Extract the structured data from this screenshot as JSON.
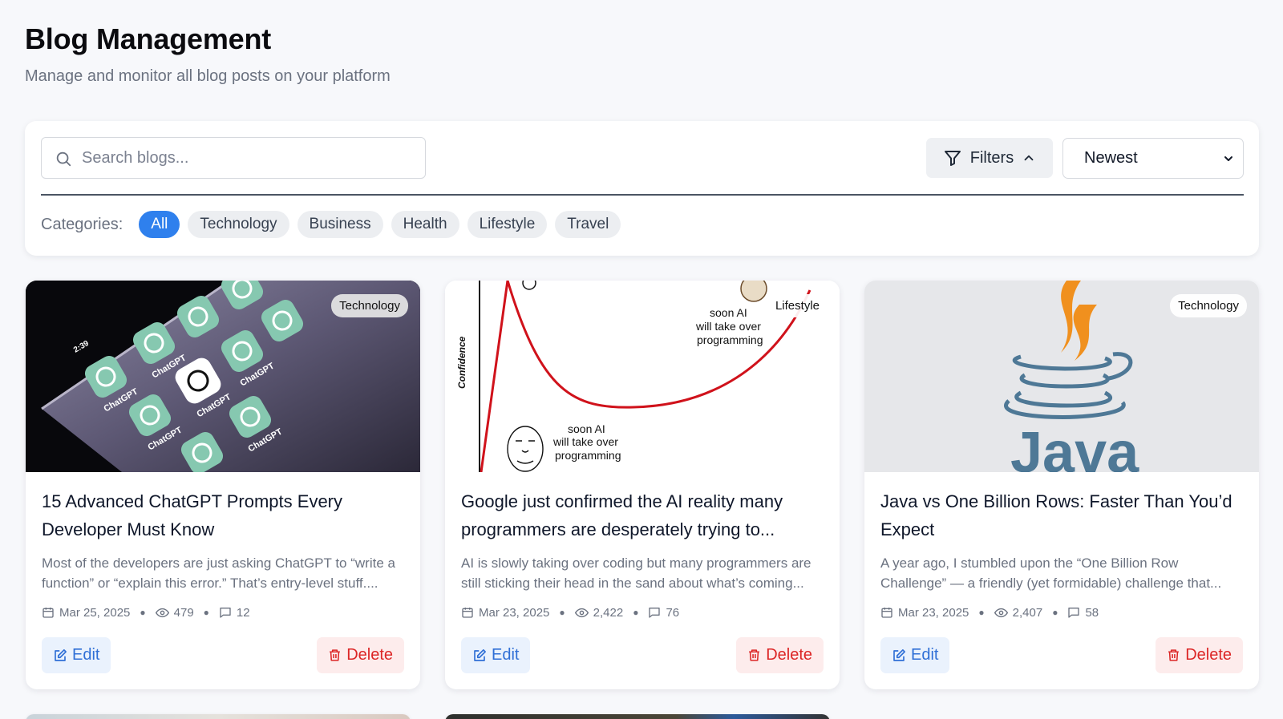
{
  "header": {
    "title": "Blog Management",
    "subtitle": "Manage and monitor all blog posts on your platform"
  },
  "toolbar": {
    "search_placeholder": "Search blogs...",
    "filters_label": "Filters",
    "sort_value": "Newest",
    "categories_label": "Categories:",
    "categories": [
      "All",
      "Technology",
      "Business",
      "Health",
      "Lifestyle",
      "Travel"
    ],
    "active_category": "All"
  },
  "posts": [
    {
      "category": "Technology",
      "title": "15 Advanced ChatGPT Prompts Every Developer Must Know",
      "excerpt": "Most of the developers are just asking ChatGPT to “write a function” or “explain this error.” That’s entry-level stuff....",
      "date": "Mar 25, 2025",
      "views": "479",
      "comments": "12",
      "edit_label": "Edit",
      "delete_label": "Delete",
      "image_app_label": "ChatGPT",
      "image_time": "2:39"
    },
    {
      "category": "Lifestyle",
      "title": "Google just confirmed the AI reality many programmers are desperately trying to...",
      "excerpt": "AI is slowly taking over coding but many programmers are still sticking their head in the sand about what’s coming...",
      "date": "Mar 23, 2025",
      "views": "2,422",
      "comments": "76",
      "edit_label": "Edit",
      "delete_label": "Delete",
      "image_axis_label": "Confidence",
      "image_caption_top": [
        "soon AI",
        "will take over",
        "programming"
      ],
      "image_caption_bottom": [
        "soon AI",
        "will take over",
        "programming"
      ]
    },
    {
      "category": "Technology",
      "title": "Java vs One Billion Rows: Faster Than You’d Expect",
      "excerpt": "A year ago, I stumbled upon the “One Billion Row Challenge” — a friendly (yet formidable) challenge that...",
      "date": "Mar 23, 2025",
      "views": "2,407",
      "comments": "58",
      "edit_label": "Edit",
      "delete_label": "Delete"
    }
  ],
  "colors": {
    "accent": "#2f80ed",
    "delete": "#dc2626",
    "edit": "#2f6fd6",
    "java_orange": "#f0901e",
    "java_blue": "#4e7896"
  }
}
